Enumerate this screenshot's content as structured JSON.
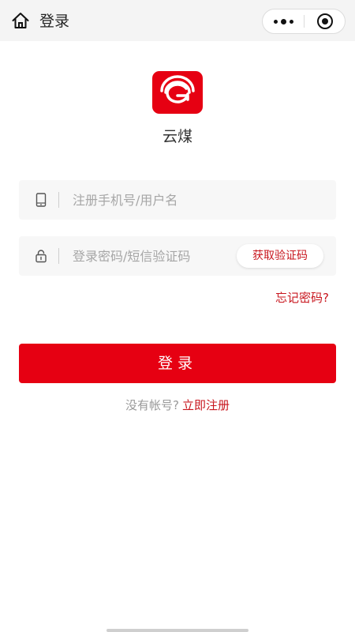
{
  "nav": {
    "title": "登录",
    "home_icon": "home-icon",
    "more_icon": "more-dots-icon",
    "close_icon": "close-target-icon"
  },
  "app": {
    "name": "云煤",
    "logo_icon": "yunmei-logo",
    "brand_color": "#e60012"
  },
  "form": {
    "phone_placeholder": "注册手机号/用户名",
    "phone_value": "",
    "phone_icon": "mobile-phone-icon",
    "password_placeholder": "登录密码/短信验证码",
    "password_value": "",
    "password_icon": "lock-icon",
    "get_code_label": "获取验证码",
    "forgot_label": "忘记密码?",
    "login_label": "登录"
  },
  "register": {
    "prompt": "没有帐号?",
    "link_label": "立即注册"
  },
  "colors": {
    "accent": "#e60012",
    "link": "#c8161e",
    "field_bg": "#f7f7f7"
  }
}
